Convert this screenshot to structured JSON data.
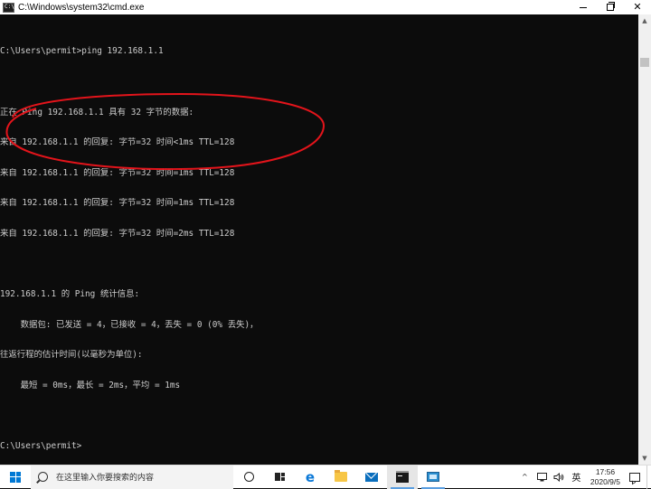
{
  "window": {
    "title": "C:\\Windows\\system32\\cmd.exe",
    "minimize_glyph": "—",
    "close_glyph": "✕"
  },
  "console": {
    "lines": [
      "C:\\Users\\permit>ping 192.168.1.1",
      "",
      "正在 Ping 192.168.1.1 具有 32 字节的数据:",
      "来自 192.168.1.1 的回复: 字节=32 时间<1ms TTL=128",
      "来自 192.168.1.1 的回复: 字节=32 时间=1ms TTL=128",
      "来自 192.168.1.1 的回复: 字节=32 时间=1ms TTL=128",
      "来自 192.168.1.1 的回复: 字节=32 时间=2ms TTL=128",
      "",
      "192.168.1.1 的 Ping 统计信息:",
      "    数据包: 已发送 = 4，已接收 = 4，丢失 = 0 (0% 丢失)，",
      "往返行程的估计时间(以毫秒为单位):",
      "    最短 = 0ms，最长 = 2ms，平均 = 1ms",
      "",
      "C:\\Users\\permit>"
    ]
  },
  "annotation": {
    "color": "#e3141b"
  },
  "taskbar": {
    "search_placeholder": "在这里输入你要搜索的内容",
    "edge_glyph": "e",
    "ime_label": "英",
    "chevron": "^",
    "time": "17:56",
    "date": "2020/9/5"
  },
  "colors": {
    "console_bg": "#0c0c0c",
    "console_fg": "#cccccc",
    "accent": "#0078d4"
  },
  "icons": [
    "app-cmd-icon",
    "minimize-icon",
    "maximize-icon",
    "close-icon",
    "windows-start-icon",
    "search-icon",
    "cortana-icon",
    "task-view-icon",
    "edge-icon",
    "file-explorer-icon",
    "mail-icon",
    "cmd-taskbar-icon",
    "remote-desktop-icon",
    "tray-chevron-icon",
    "network-icon",
    "volume-icon",
    "notification-icon"
  ]
}
